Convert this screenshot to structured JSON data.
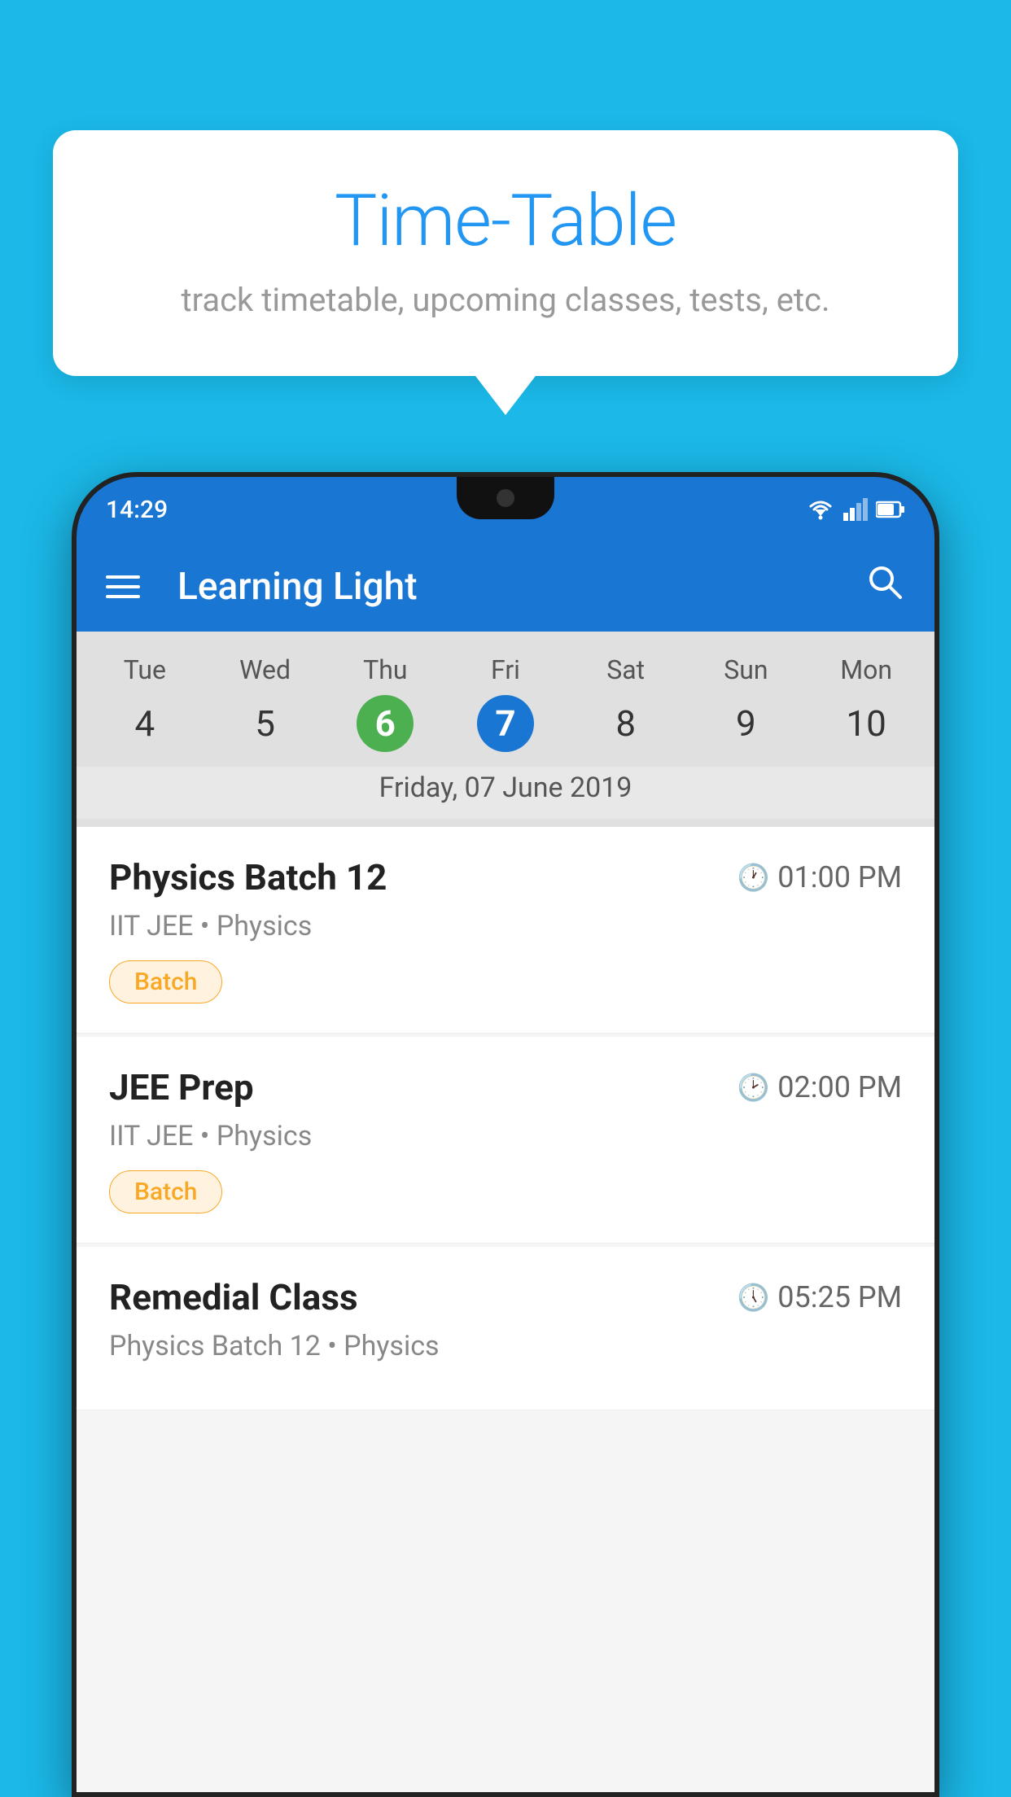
{
  "background_color": "#1BB8E8",
  "tooltip": {
    "title": "Time-Table",
    "subtitle": "track timetable, upcoming classes, tests, etc."
  },
  "phone": {
    "status_bar": {
      "time": "14:29"
    },
    "app_bar": {
      "title": "Learning Light"
    },
    "calendar": {
      "days": [
        "Tue",
        "Wed",
        "Thu",
        "Fri",
        "Sat",
        "Sun",
        "Mon"
      ],
      "dates": [
        "4",
        "5",
        "6",
        "7",
        "8",
        "9",
        "10"
      ],
      "today_index": 2,
      "selected_index": 3,
      "selected_date_label": "Friday, 07 June 2019"
    },
    "schedule": [
      {
        "title": "Physics Batch 12",
        "time": "01:00 PM",
        "subtitle": "IIT JEE • Physics",
        "badge": "Batch"
      },
      {
        "title": "JEE Prep",
        "time": "02:00 PM",
        "subtitle": "IIT JEE • Physics",
        "badge": "Batch"
      },
      {
        "title": "Remedial Class",
        "time": "05:25 PM",
        "subtitle": "Physics Batch 12 • Physics",
        "badge": ""
      }
    ]
  }
}
